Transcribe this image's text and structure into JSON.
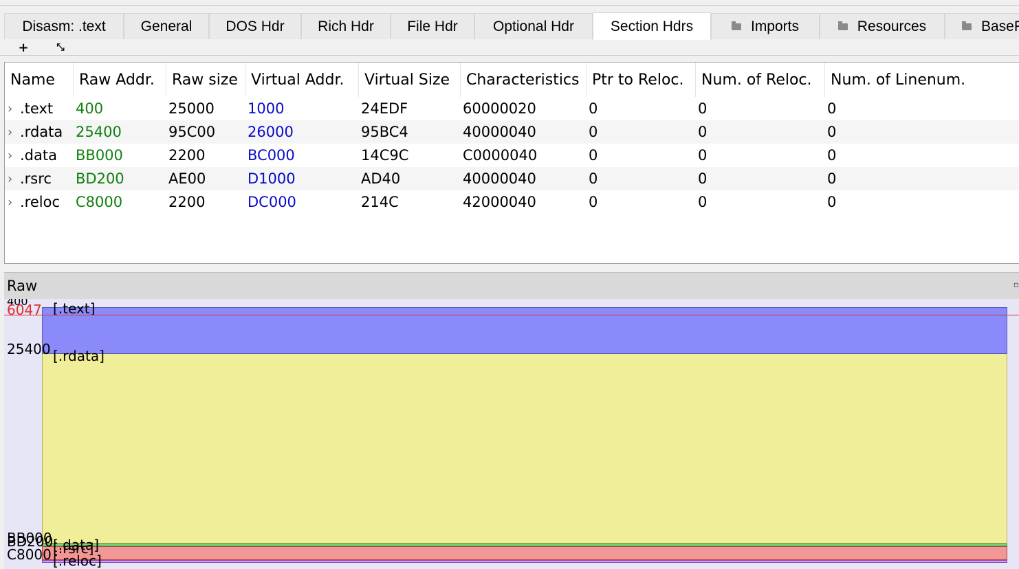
{
  "tabs": [
    {
      "label": "Disasm: .text",
      "icon": ""
    },
    {
      "label": "General",
      "icon": ""
    },
    {
      "label": "DOS Hdr",
      "icon": ""
    },
    {
      "label": "Rich Hdr",
      "icon": ""
    },
    {
      "label": "File Hdr",
      "icon": ""
    },
    {
      "label": "Optional Hdr",
      "icon": ""
    },
    {
      "label": "Section Hdrs",
      "icon": "",
      "active": true
    },
    {
      "label": "Imports",
      "icon": "folder-icon"
    },
    {
      "label": "Resources",
      "icon": "folder-icon"
    },
    {
      "label": "BaseR",
      "icon": "folder-icon"
    }
  ],
  "toolbar": {
    "add_label": "+",
    "expand_label": "⤡"
  },
  "table": {
    "columns": [
      "Name",
      "Raw Addr.",
      "Raw size",
      "Virtual Addr.",
      "Virtual Size",
      "Characteristics",
      "Ptr to Reloc.",
      "Num. of Reloc.",
      "Num. of Linenum."
    ],
    "rows": [
      {
        "name": ".text",
        "raw_addr": "400",
        "raw_size": "25000",
        "virtual_addr": "1000",
        "virtual_size": "24EDF",
        "characteristics": "60000020",
        "ptr_reloc": "0",
        "num_reloc": "0",
        "num_linenum": "0"
      },
      {
        "name": ".rdata",
        "raw_addr": "25400",
        "raw_size": "95C00",
        "virtual_addr": "26000",
        "virtual_size": "95BC4",
        "characteristics": "40000040",
        "ptr_reloc": "0",
        "num_reloc": "0",
        "num_linenum": "0"
      },
      {
        "name": ".data",
        "raw_addr": "BB000",
        "raw_size": "2200",
        "virtual_addr": "BC000",
        "virtual_size": "14C9C",
        "characteristics": "C0000040",
        "ptr_reloc": "0",
        "num_reloc": "0",
        "num_linenum": "0"
      },
      {
        "name": ".rsrc",
        "raw_addr": "BD200",
        "raw_size": "AE00",
        "virtual_addr": "D1000",
        "virtual_size": "AD40",
        "characteristics": "40000040",
        "ptr_reloc": "0",
        "num_reloc": "0",
        "num_linenum": "0"
      },
      {
        "name": ".reloc",
        "raw_addr": "C8000",
        "raw_size": "2200",
        "virtual_addr": "DC000",
        "virtual_size": "214C",
        "characteristics": "42000040",
        "ptr_reloc": "0",
        "num_reloc": "0",
        "num_linenum": "0"
      }
    ]
  },
  "raw": {
    "title": "Raw",
    "cursor_addr": "6047",
    "top_addr": "400",
    "segments": [
      {
        "label": "[.text]",
        "addr": "",
        "color": "#8a8afb"
      },
      {
        "label": "[.rdata]",
        "addr": "25400",
        "color": "#f0ee98"
      },
      {
        "label": "[.data]",
        "addr": "BB000",
        "color": "#7ddc7d"
      },
      {
        "label": "[.rsrc]",
        "addr": "BD200",
        "color": "#f29696"
      },
      {
        "label": "[.reloc]",
        "addr": "C8000",
        "color": "#d8a0f0"
      }
    ],
    "colors": {
      "cursor": "#e03030",
      "addr_green": "#108010",
      "addr_blue": "#0a0acc"
    }
  }
}
